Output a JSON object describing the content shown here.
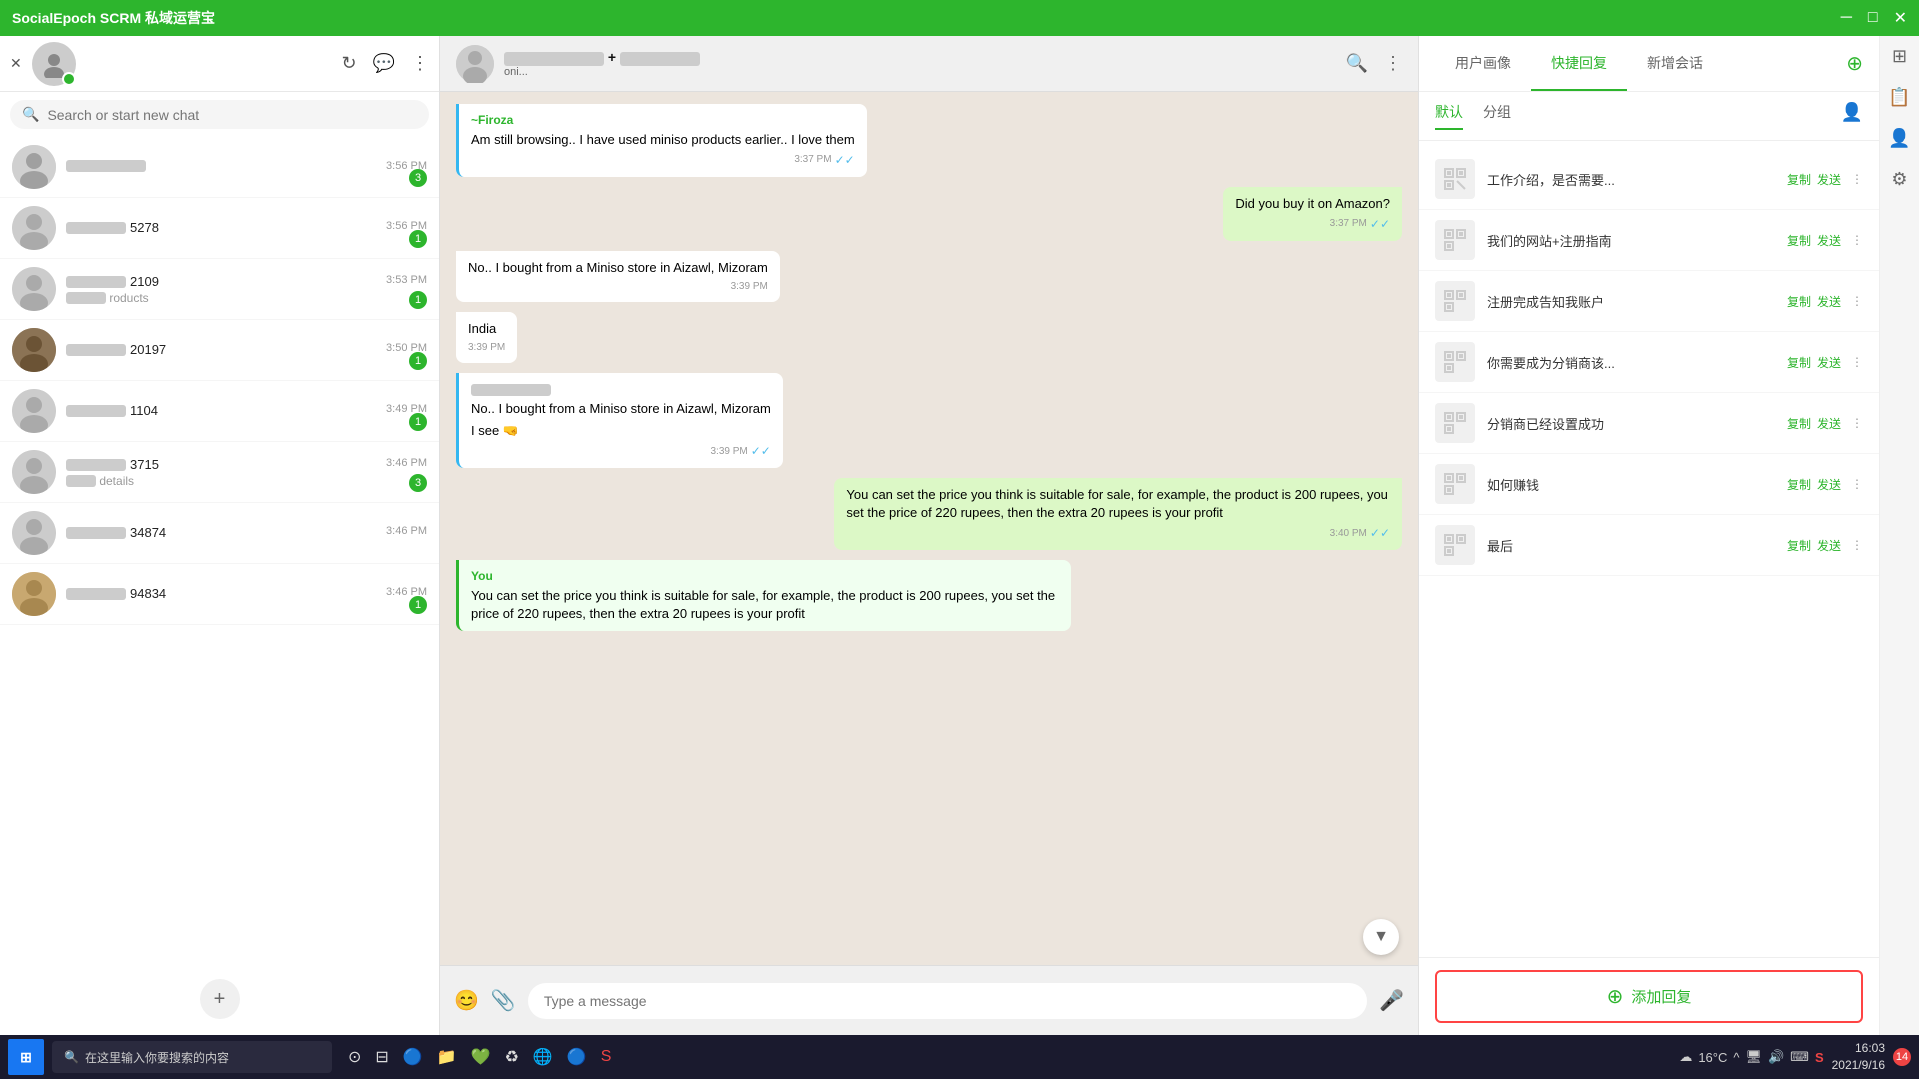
{
  "app": {
    "title": "SocialEpoch SCRM 私域运营宝",
    "min_btn": "─",
    "max_btn": "□",
    "close_btn": "✕"
  },
  "sidebar": {
    "search_placeholder": "Search or start new chat",
    "contacts": [
      {
        "id": 1,
        "name_suffix": "blurred",
        "time": "3:56 PM",
        "preview": "",
        "badge": 3,
        "has_photo": true
      },
      {
        "id": 2,
        "name_suffix": "5278",
        "time": "3:56 PM",
        "preview": "",
        "badge": 1,
        "has_photo": false
      },
      {
        "id": 3,
        "name_suffix": "2109",
        "time": "3:53 PM",
        "preview": "roducts",
        "badge": 1,
        "has_photo": false
      },
      {
        "id": 4,
        "name_suffix": "20197",
        "time": "3:50 PM",
        "preview": "",
        "badge": 1,
        "has_photo": true
      },
      {
        "id": 5,
        "name_suffix": "1104",
        "time": "3:49 PM",
        "preview": "",
        "badge": 1,
        "has_photo": false
      },
      {
        "id": 6,
        "name_suffix": "3715",
        "time": "3:46 PM",
        "preview": "details",
        "badge": 3,
        "has_photo": false
      },
      {
        "id": 7,
        "name_suffix": "34874",
        "time": "3:46 PM",
        "preview": "",
        "badge": 0,
        "has_photo": false
      },
      {
        "id": 8,
        "name_suffix": "94834",
        "time": "3:46 PM",
        "preview": "",
        "badge": 1,
        "has_photo": true
      }
    ]
  },
  "chat": {
    "header_name": "blurred",
    "header_status": "oni...",
    "messages": [
      {
        "id": 1,
        "type": "received",
        "sender": "~Firoza",
        "text": "Am still browsing.. I have used miniso products earlier.. I love them",
        "time": "3:37 PM",
        "ticks": "✓✓",
        "highlight": true
      },
      {
        "id": 2,
        "type": "sent",
        "text": "Did you buy it on Amazon?",
        "time": "3:37 PM",
        "ticks": "✓✓"
      },
      {
        "id": 3,
        "type": "received",
        "text": "No.. I bought from a Miniso store in Aizawl, Mizoram",
        "time": "3:39 PM"
      },
      {
        "id": 4,
        "type": "received",
        "text": "India",
        "time": "3:39 PM"
      },
      {
        "id": 5,
        "type": "received",
        "sender": "blurred",
        "text": "No.. I bought from a Miniso store in Aizawl, Mizoram",
        "sub_text": "I see 🤜",
        "time": "3:39 PM",
        "ticks": "✓✓",
        "highlight": true
      },
      {
        "id": 6,
        "type": "sent",
        "text": "You can set the price you think is suitable for sale, for example, the product is 200 rupees, you set the price of 220 rupees, then the extra 20 rupees is your profit",
        "time": "3:40 PM",
        "ticks": "✓✓"
      },
      {
        "id": 7,
        "type": "you_preview",
        "sender": "You",
        "text": "You can set the price you think is suitable for sale, for example, the product is 200 rupees, you set the price of 220 rupees, then the extra 20 rupees is your profit"
      }
    ],
    "input_placeholder": "Type a message"
  },
  "right_panel": {
    "tabs": [
      "用户画像",
      "快捷回复",
      "新增会话"
    ],
    "active_tab": "快捷回复",
    "sub_tabs": [
      "默认",
      "分组"
    ],
    "active_sub": "默认",
    "quick_replies": [
      {
        "id": 1,
        "text": "工作介绍，是否需要...",
        "copy": "复制",
        "send": "发送"
      },
      {
        "id": 2,
        "text": "我们的网站+注册指南",
        "copy": "复制",
        "send": "发送"
      },
      {
        "id": 3,
        "text": "注册完成告知我账户",
        "copy": "复制",
        "send": "发送"
      },
      {
        "id": 4,
        "text": "你需要成为分销商该...",
        "copy": "复制",
        "send": "发送"
      },
      {
        "id": 5,
        "text": "分销商已经设置成功",
        "copy": "复制",
        "send": "发送"
      },
      {
        "id": 6,
        "text": "如何赚钱",
        "copy": "复制",
        "send": "发送"
      },
      {
        "id": 7,
        "text": "最后",
        "copy": "复制",
        "send": "发送"
      }
    ],
    "add_reply_label": "添加回复",
    "menu_icon": "⊕"
  },
  "taskbar": {
    "search_label": "在这里输入你要搜索的内容",
    "time": "16:03",
    "date": "2021/9/16",
    "temperature": "16°C",
    "notification_count": "14"
  }
}
